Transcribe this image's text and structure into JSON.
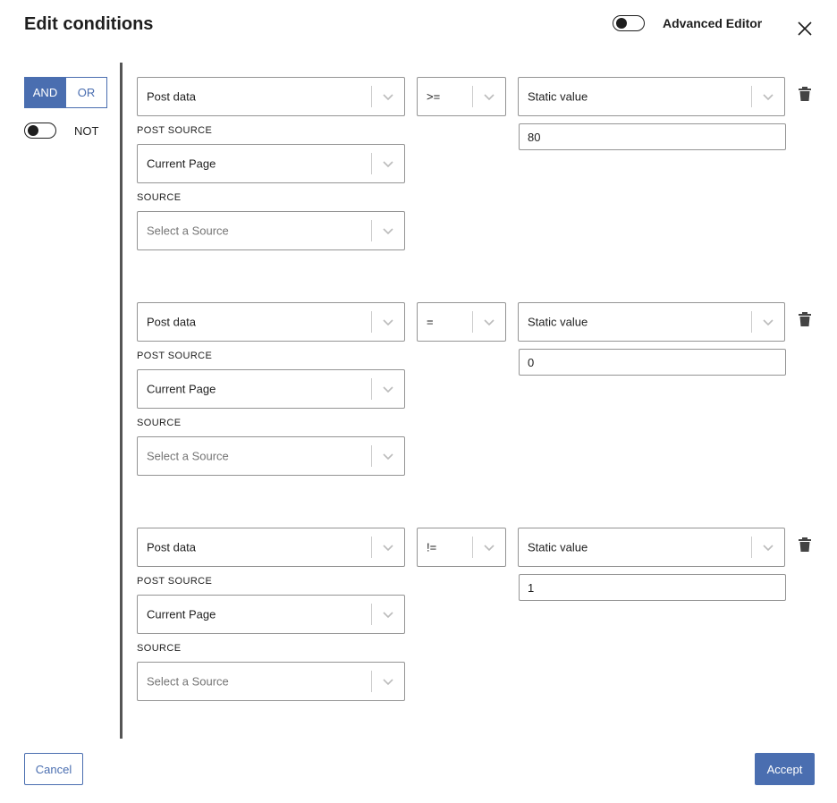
{
  "dialog": {
    "title": "Edit conditions",
    "advanced_editor_label": "Advanced Editor",
    "advanced_editor_on": false
  },
  "logic": {
    "and_label": "AND",
    "or_label": "OR",
    "selected": "AND",
    "not_label": "NOT",
    "not_on": false
  },
  "labels": {
    "post_source": "POST SOURCE",
    "source": "SOURCE"
  },
  "conditions": [
    {
      "field": "Post data",
      "operator": ">=",
      "value_type": "Static value",
      "value": "80",
      "post_source": "Current Page",
      "source_placeholder": "Select a Source"
    },
    {
      "field": "Post data",
      "operator": "=",
      "value_type": "Static value",
      "value": "0",
      "post_source": "Current Page",
      "source_placeholder": "Select a Source"
    },
    {
      "field": "Post data",
      "operator": "!=",
      "value_type": "Static value",
      "value": "1",
      "post_source": "Current Page",
      "source_placeholder": "Select a Source"
    }
  ],
  "footer": {
    "cancel_label": "Cancel",
    "accept_label": "Accept"
  },
  "colors": {
    "accent": "#4a6eb0",
    "divider": "#555555"
  }
}
